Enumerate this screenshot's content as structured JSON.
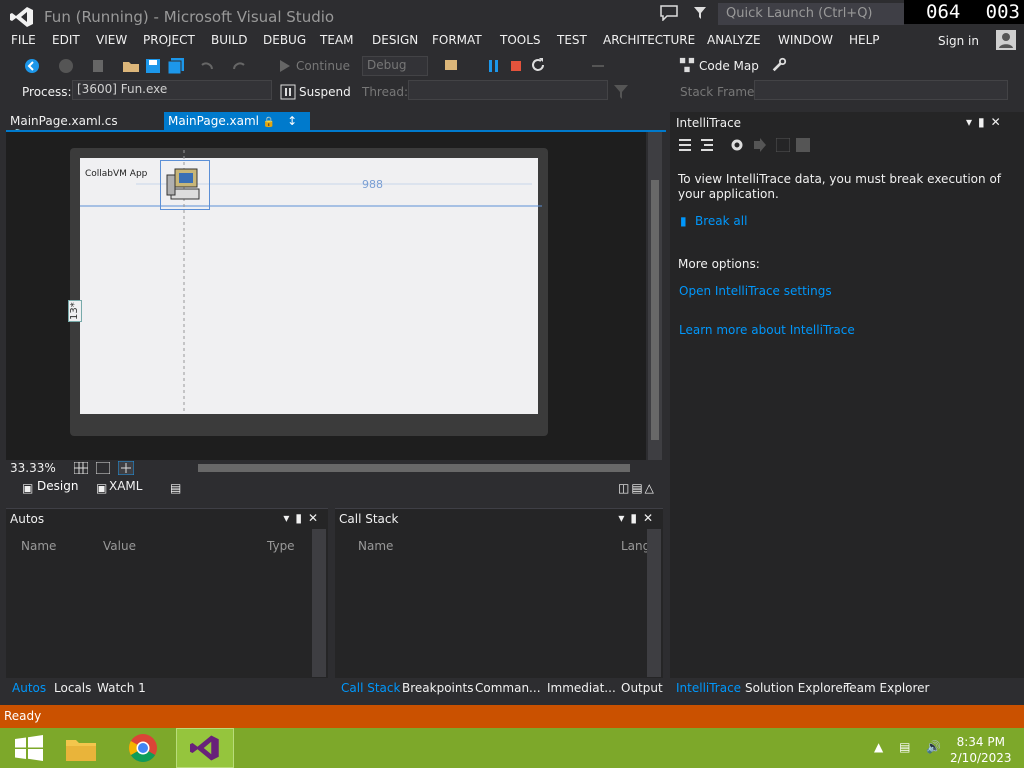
{
  "window": {
    "title": "Fun (Running) - Microsoft Visual Studio"
  },
  "quick_launch": {
    "placeholder": "Quick Launch (Ctrl+Q)"
  },
  "counter": {
    "left": "064",
    "right": "003"
  },
  "menu": {
    "items": [
      "FILE",
      "EDIT",
      "VIEW",
      "PROJECT",
      "BUILD",
      "DEBUG",
      "TEAM",
      "DESIGN",
      "FORMAT",
      "TOOLS",
      "TEST",
      "ARCHITECTURE",
      "ANALYZE",
      "WINDOW",
      "HELP"
    ],
    "signin": "Sign in"
  },
  "toolbar": {
    "continue_label": "Continue",
    "config_value": "Debug",
    "codemap_label": "Code Map"
  },
  "debug_toolbar": {
    "process_label": "Process:",
    "process_value": "[3600] Fun.exe",
    "suspend_label": "Suspend",
    "thread_label": "Thread:",
    "stackframe_label": "Stack Frame:"
  },
  "doc_tabs": [
    {
      "label": "MainPage.xaml.cs"
    },
    {
      "label": "MainPage.xaml"
    }
  ],
  "designer": {
    "app_label": "CollabVM App",
    "width_value": "988",
    "grid_row": "13*",
    "zoom": "33.33%",
    "view_tabs": [
      "Design",
      "XAML"
    ]
  },
  "autos": {
    "title": "Autos",
    "columns": [
      "Name",
      "Value",
      "Type"
    ],
    "tabs": [
      "Autos",
      "Locals",
      "Watch 1"
    ]
  },
  "callstack": {
    "title": "Call Stack",
    "columns": [
      "Name",
      "Lang"
    ],
    "tabs": [
      "Call Stack",
      "Breakpoints",
      "Comman...",
      "Immediat...",
      "Output"
    ]
  },
  "intellitrace": {
    "title": "IntelliTrace",
    "message": "To view IntelliTrace data, you must break execution of your application.",
    "break_all": "Break all",
    "more_options": "More options:",
    "settings_link": "Open IntelliTrace settings",
    "learn_link": "Learn more about IntelliTrace",
    "tabs": [
      "IntelliTrace",
      "Solution Explorer",
      "Team Explorer"
    ]
  },
  "status": {
    "text": "Ready"
  },
  "taskbar": {
    "time": "8:34 PM",
    "date": "2/10/2023"
  },
  "colors": {
    "accent": "#007acc",
    "status_bar": "#ca5100",
    "taskbar": "#7da82a",
    "link": "#0097fb"
  }
}
